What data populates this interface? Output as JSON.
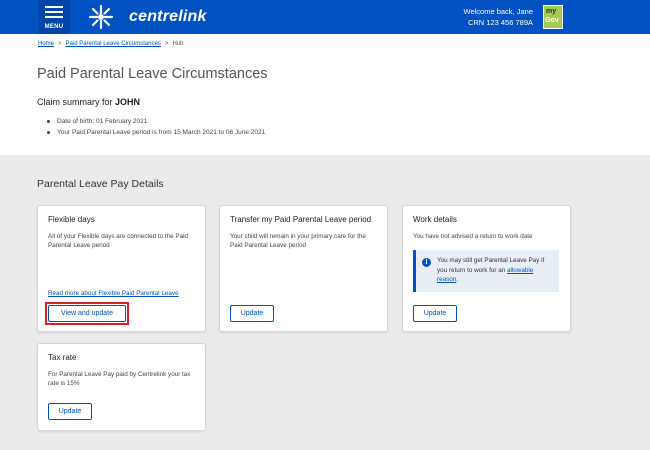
{
  "header": {
    "menu_label": "MENU",
    "brand_name": "centrelink",
    "welcome": "Welcome back, Jane",
    "crn": "CRN 123 456 789A",
    "mygov_top": "my",
    "mygov_bottom": "Gov"
  },
  "breadcrumb": {
    "home": "Home",
    "separator": ">",
    "circumstances": "Paid Parental Leave Circumstances",
    "current": "Hub"
  },
  "page": {
    "title": "Paid Parental Leave Circumstances",
    "claim_prefix": "Claim summary for",
    "claim_name": "JOHN",
    "bullets": [
      "Date of birth: 01 February 2021",
      "Your Paid Parental Leave period is from 15 March 2021 to 06 June 2021"
    ]
  },
  "section": {
    "title": "Parental Leave Pay Details"
  },
  "cards": {
    "flexible": {
      "title": "Flexible days",
      "body": "All of your Flexible days are connected to the Paid Parental Leave period",
      "link": "Read more about Flexible Paid Parental Leave",
      "button": "View and update"
    },
    "transfer": {
      "title": "Transfer my Paid Parental Leave period",
      "body": "Your child will remain in your primary care for the Paid Parental Leave period",
      "button": "Update"
    },
    "work": {
      "title": "Work details",
      "body": "You have not advised a return to work date",
      "info_text": "You may still get Parental Leave Pay if you return to work for an",
      "info_link": "allowable reason",
      "info_end": ".",
      "button": "Update"
    },
    "tax": {
      "title": "Tax rate",
      "body": "For Parental Leave Pay paid by Centrelink your tax rate is 15%",
      "button": "Update"
    }
  },
  "colors": {
    "brand_blue": "#0052c2",
    "mygov_green": "#a7c957",
    "focus_red": "#d6202a"
  },
  "icons": {
    "menu": "hamburger-icon",
    "brand": "centrelink-star-logo",
    "info": "info-icon"
  }
}
